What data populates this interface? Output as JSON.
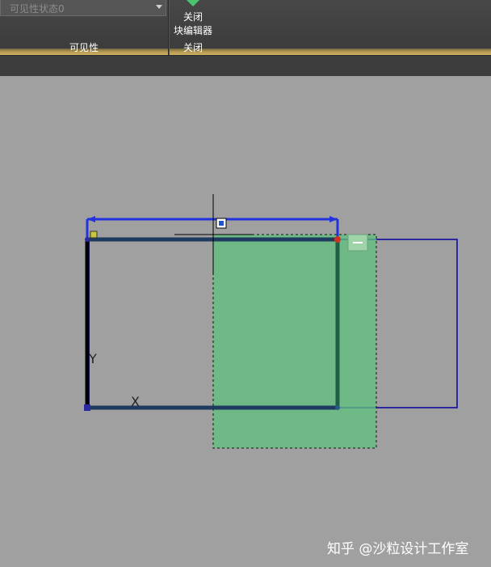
{
  "ribbon": {
    "visibility_panel": {
      "state_dropdown_value": "可见性状态0",
      "panel_label": "可见性"
    },
    "close_panel": {
      "button_line1": "关闭",
      "button_line2": "块编辑器",
      "panel_label": "关闭"
    }
  },
  "drawing": {
    "axis_y_label": "Y",
    "axis_x_label": "X",
    "colors": {
      "canvas": "#a0a0a0",
      "selection_fill": "#5fc27f",
      "param_line": "#2233dd",
      "rect_outline": "#2a2aa0"
    }
  },
  "watermark": "知乎 @沙粒设计工作室"
}
